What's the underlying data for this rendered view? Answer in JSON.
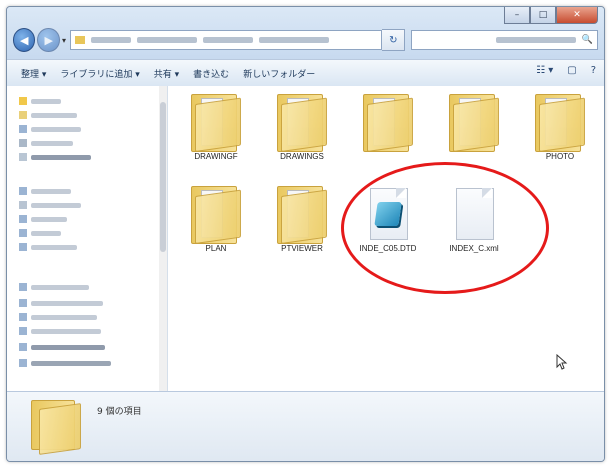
{
  "window": {
    "caption_buttons": [
      "–",
      "□",
      "✕"
    ],
    "nav": {
      "back": "◀",
      "forward": "▶",
      "dropdown": "▾",
      "refresh": "↻",
      "search_icon": "🔍"
    },
    "icons": {
      "back": "back-arrow-icon",
      "forward": "forward-arrow-icon",
      "refresh": "refresh-icon",
      "search": "search-icon"
    }
  },
  "toolbar": {
    "items": [
      "整理 ▾",
      "ライブラリに追加 ▾",
      "共有 ▾",
      "書き込む",
      "新しいフォルダー"
    ],
    "right_icons": [
      "☷ ▾",
      "▢",
      "?"
    ]
  },
  "content": {
    "folders_row1": [
      {
        "label": "DRAWINGF"
      },
      {
        "label": "DRAWINGS"
      },
      {
        "label": ""
      },
      {
        "label": ""
      },
      {
        "label": "PHOTO"
      }
    ],
    "folders_row2": [
      {
        "label": "PLAN"
      },
      {
        "label": "PTVIEWER"
      }
    ],
    "files": [
      {
        "label": "INDE_C05.DTD",
        "icon": "dtd-file-icon"
      },
      {
        "label": "INDEX_C.xml",
        "icon": "xml-file-icon"
      }
    ]
  },
  "details": {
    "count_text": "9 個の項目"
  },
  "colors": {
    "highlight": "#e51a1a",
    "folder": "#f0d77f"
  }
}
